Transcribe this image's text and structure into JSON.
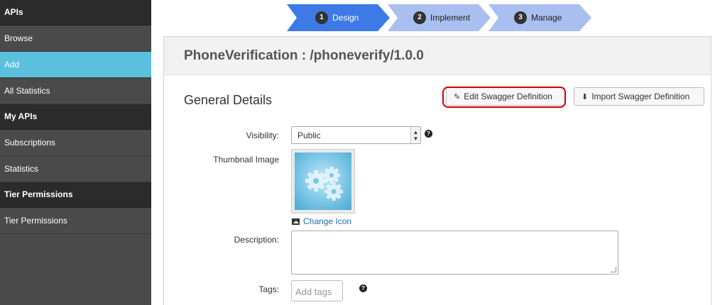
{
  "sidebar": {
    "sections": [
      {
        "heading": "APIs",
        "items": [
          {
            "label": "Browse",
            "active": false
          },
          {
            "label": "Add",
            "active": true
          },
          {
            "label": "All Statistics",
            "active": false
          }
        ]
      },
      {
        "heading": "My APIs",
        "items": [
          {
            "label": "Subscriptions",
            "active": false
          },
          {
            "label": "Statistics",
            "active": false
          }
        ]
      },
      {
        "heading": "Tier Permissions",
        "items": [
          {
            "label": "Tier Permissions",
            "active": false
          }
        ]
      }
    ]
  },
  "steps": [
    {
      "num": "1",
      "label": "Design",
      "active": true
    },
    {
      "num": "2",
      "label": "Implement",
      "active": false
    },
    {
      "num": "3",
      "label": "Manage",
      "active": false
    }
  ],
  "panel": {
    "title": "PhoneVerification : /phoneverify/1.0.0",
    "section_title": "General Details",
    "edit_button": "Edit Swagger Definition",
    "import_button": "Import Swagger Definition"
  },
  "form": {
    "visibility_label": "Visibility:",
    "visibility_value": "Public",
    "thumbnail_label": "Thumbnail Image",
    "change_icon": "Change Icon",
    "description_label": "Description:",
    "tags_label": "Tags:",
    "tags_placeholder": "Add tags",
    "help_glyph": "?"
  },
  "colors": {
    "active_step": "#3d7ae6",
    "inactive_step": "#a9bfef",
    "sidebar_active": "#5bc0de",
    "highlight": "#d40000"
  }
}
